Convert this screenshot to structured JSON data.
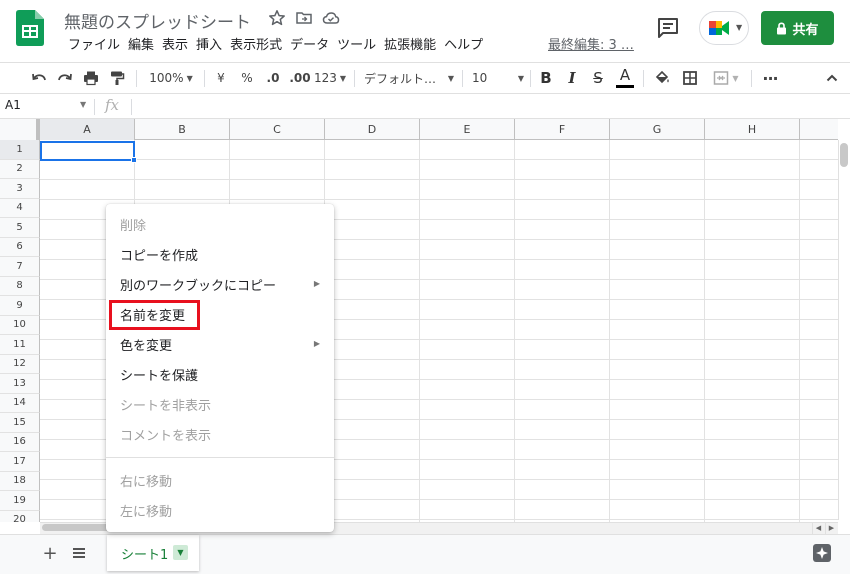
{
  "header": {
    "title": "無題のスプレッドシート",
    "last_edit": "最終編集: 3 …",
    "share_label": "共有",
    "menu": [
      "ファイル",
      "編集",
      "表示",
      "挿入",
      "表示形式",
      "データ",
      "ツール",
      "拡張機能",
      "ヘルプ"
    ]
  },
  "toolbar": {
    "zoom": "100%",
    "currency": "¥",
    "percent": "%",
    "decimal_decrease": ".0",
    "decimal_increase": ".00",
    "more_formats": "123",
    "font": "デフォルト…",
    "font_size": "10",
    "bold": "B",
    "italic": "I",
    "strike": "S",
    "text_color": "A"
  },
  "formula_bar": {
    "cell_ref": "A1",
    "fx_label": "fx"
  },
  "grid": {
    "columns": [
      "A",
      "B",
      "C",
      "D",
      "E",
      "F",
      "G",
      "H"
    ],
    "rows": [
      "1",
      "2",
      "3",
      "4",
      "5",
      "6",
      "7",
      "8",
      "9",
      "10",
      "11",
      "12",
      "13",
      "14",
      "15",
      "16",
      "17",
      "18",
      "19",
      "20"
    ]
  },
  "context_menu": {
    "items": [
      {
        "label": "削除",
        "disabled": true,
        "submenu": false
      },
      {
        "label": "コピーを作成",
        "disabled": false,
        "submenu": false
      },
      {
        "label": "別のワークブックにコピー",
        "disabled": false,
        "submenu": true
      },
      {
        "label": "名前を変更",
        "disabled": false,
        "submenu": false
      },
      {
        "label": "色を変更",
        "disabled": false,
        "submenu": true
      },
      {
        "label": "シートを保護",
        "disabled": false,
        "submenu": false
      },
      {
        "label": "シートを非表示",
        "disabled": true,
        "submenu": false
      },
      {
        "label": "コメントを表示",
        "disabled": true,
        "submenu": false
      },
      {
        "label": "右に移動",
        "disabled": true,
        "submenu": false
      },
      {
        "label": "左に移動",
        "disabled": true,
        "submenu": false
      }
    ],
    "highlighted": "名前を変更"
  },
  "sheets": {
    "tabs": [
      {
        "name": "シート1",
        "active": true
      }
    ]
  },
  "colors": {
    "share_green": "#1e8e3e",
    "selection_blue": "#1a73e8",
    "highlight_red": "#e8101e",
    "sheet_tab_text": "#188038"
  }
}
